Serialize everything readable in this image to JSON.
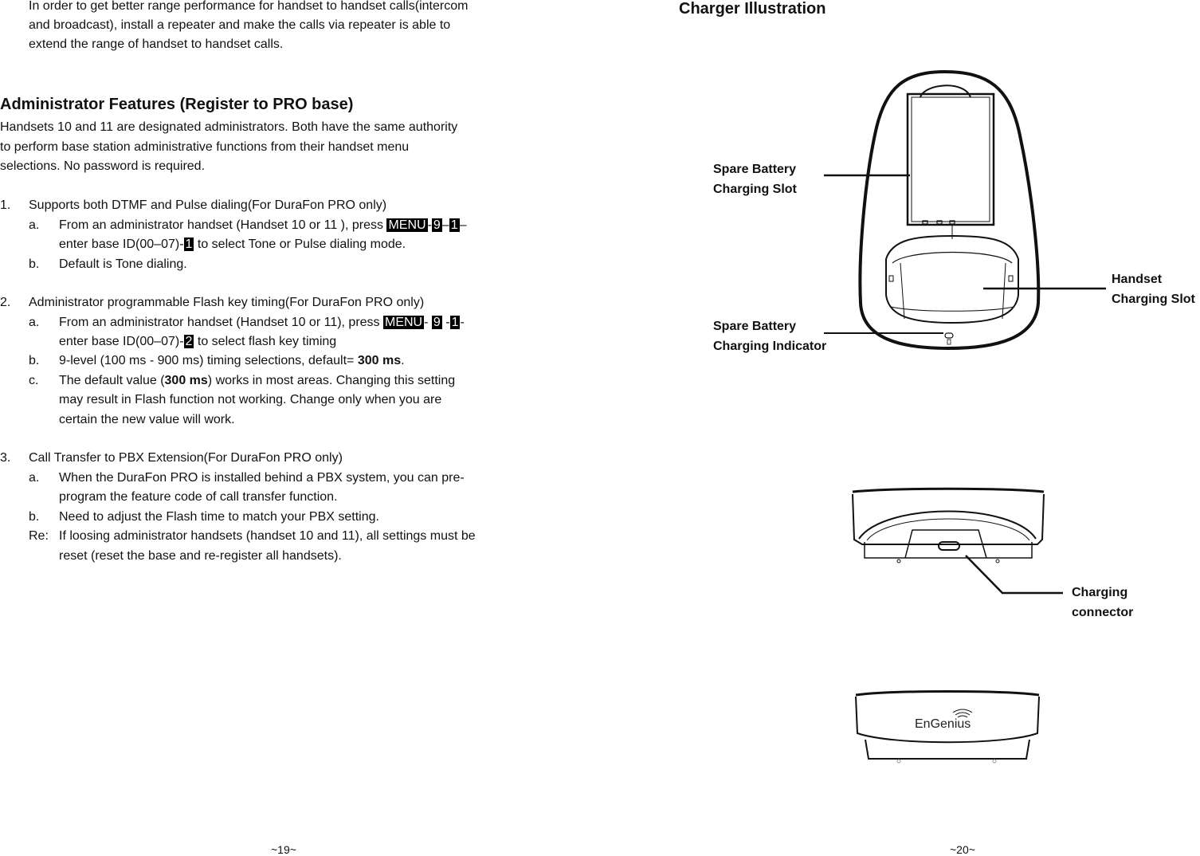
{
  "left_page": {
    "intro": [
      "In order to get better range performance for handset to handset calls(intercom",
      "and broadcast), install a repeater and make the calls via repeater is able to",
      "extend the range of handset to handset calls."
    ],
    "heading": "Administrator Features (Register to PRO base)",
    "para": [
      "Handsets 10 and 11 are designated administrators.  Both have the same authority",
      "to perform base station administrative functions from their handset menu",
      "selections.  No password is required."
    ],
    "sections": [
      {
        "num": "1.",
        "title": "Supports both DTMF and Pulse dialing(For DuraFon PRO only)",
        "a_label": "a.",
        "a_pre": "From an administrator handset (Handset 10 or 11 ), press ",
        "a_keys": [
          "MENU",
          "9",
          "1"
        ],
        "a_seps": [
          "-",
          "–",
          "–"
        ],
        "a_line2_pre": "enter base ID(00–07)-",
        "a_key2": "1",
        "a_line2_post": " to select Tone or Pulse dialing mode.",
        "b_label": "b.",
        "b_text": "Default is Tone dialing."
      },
      {
        "num": "2.",
        "title": "Administrator programmable Flash key timing(For DuraFon PRO only)",
        "a_label": "a.",
        "a_pre": "From an administrator handset (Handset 10 or 11), press ",
        "a_keys": [
          "MENU",
          "9",
          "1"
        ],
        "a_seps": [
          "- ",
          " -",
          "-"
        ],
        "a_line2_pre": "enter base ID(00–07)-",
        "a_key2": "2",
        "a_line2_post": " to select flash key timing",
        "b_label": "b.",
        "b_pre": "9-level (100 ms  - 900 ms) timing selections, default= ",
        "b_bold": "300 ms",
        "b_post": ".",
        "c_label": "c.",
        "c_pre": "The default value (",
        "c_bold": "300 ms",
        "c_post": ") works in most areas.  Changing this setting",
        "c_line2": "may result in Flash function not working.  Change only when you are",
        "c_line3": "certain the new value will work."
      },
      {
        "num": "3.",
        "title": "Call Transfer to PBX Extension(For DuraFon PRO only)",
        "a_label": "a.",
        "a_line1": "When the DuraFon PRO is installed behind a PBX system, you can pre-",
        "a_line2": "program the feature code of call transfer function.",
        "b_label": "b.",
        "b_text": "Need to adjust the Flash time to match your PBX setting.",
        "re_label": "Re:",
        "re_line1": "If loosing administrator handsets (handset 10 and 11), all settings must be",
        "re_line2": "reset (reset the base and re-register all handsets)."
      }
    ],
    "page_number": "~19~"
  },
  "right_page": {
    "heading": "Charger Illustration",
    "labels": {
      "spare_slot": [
        "Spare Battery",
        "Charging Slot"
      ],
      "spare_indicator": [
        "Spare Battery",
        "Charging Indicator"
      ],
      "handset_slot": [
        "Handset",
        "Charging Slot"
      ],
      "connector": [
        "Charging",
        "connector"
      ]
    },
    "brand_logo": "EnGenius",
    "page_number": "~20~"
  }
}
